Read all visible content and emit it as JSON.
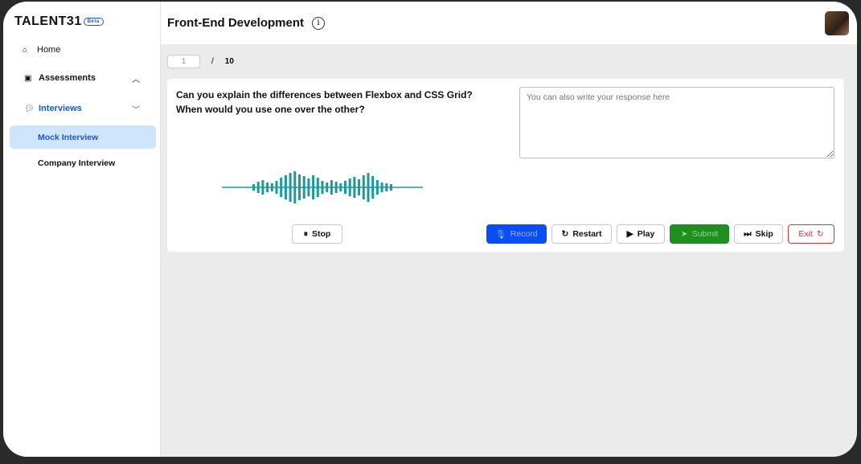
{
  "sidebar": {
    "logo": "TALENT31",
    "badge": "Beta",
    "items": [
      {
        "label": "Home",
        "icon": "home-icon"
      },
      {
        "label": "Assessments",
        "icon": "clipboard-icon"
      },
      {
        "label": "Interviews",
        "icon": "chat-icon"
      }
    ],
    "sub_items": [
      {
        "label": "Mock Interview",
        "active": true
      },
      {
        "label": "Company Interview"
      }
    ]
  },
  "header": {
    "title": "Front-End Development"
  },
  "pager": {
    "current": "1",
    "separator": "/",
    "total": "10"
  },
  "question": {
    "text": "Can you explain the differences between Flexbox and CSS Grid? When would you use one over the other?"
  },
  "response": {
    "placeholder": "You can also write your response here"
  },
  "buttons": {
    "stop": "Stop",
    "record": "Record",
    "restart": "Restart",
    "play": "Play",
    "submit": "Submit",
    "skip": "Skip",
    "exit": "Exit"
  },
  "colors": {
    "accent": "#1a56db",
    "record": "#0a4cf5",
    "submit": "#1e8e1e",
    "exit": "#d33",
    "wave": "#1a9a9a",
    "active_bg": "#cfe5fb"
  }
}
